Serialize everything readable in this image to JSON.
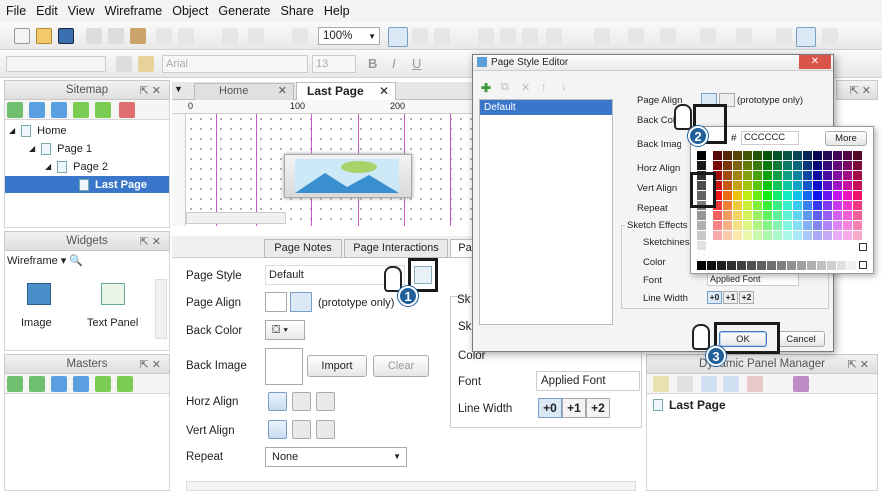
{
  "menu": [
    "File",
    "Edit",
    "View",
    "Wireframe",
    "Object",
    "Generate",
    "Share",
    "Help"
  ],
  "toolbar": {
    "zoom": "100%",
    "font_name": "Arial",
    "font_size": "13"
  },
  "sitemap": {
    "title": "Sitemap",
    "pages": [
      {
        "label": "Home",
        "level": 0
      },
      {
        "label": "Page 1",
        "level": 1
      },
      {
        "label": "Page 2",
        "level": 2
      },
      {
        "label": "Last Page",
        "level": 3,
        "selected": true
      }
    ]
  },
  "widgets": {
    "title": "Widgets",
    "library": "Wireframe",
    "items": [
      {
        "label": "Image"
      },
      {
        "label": "Text Panel"
      }
    ]
  },
  "masters": {
    "title": "Masters"
  },
  "canvas": {
    "tabs": [
      {
        "label": "Home"
      },
      {
        "label": "Last Page",
        "active": true
      }
    ],
    "ruler": [
      "0",
      "100",
      "200"
    ]
  },
  "page_props": {
    "tabs": [
      "Page Notes",
      "Page Interactions",
      "Pa"
    ],
    "page_style_label": "Page Style",
    "page_style_value": "Default",
    "page_align_label": "Page Align",
    "prototype_only": "(prototype only)",
    "back_color_label": "Back Color",
    "back_image_label": "Back Image",
    "import_label": "Import",
    "clear_label": "Clear",
    "horz_align_label": "Horz Align",
    "vert_align_label": "Vert Align",
    "repeat_label": "Repeat",
    "repeat_value": "None"
  },
  "sketch_panel": {
    "title": "Sk",
    "sketchiness_label": "Sk",
    "color_label": "Color",
    "font_label": "Font",
    "font_value": "Applied Font",
    "line_width_label": "Line Width",
    "lw_options": [
      "+0",
      "+1",
      "+2"
    ]
  },
  "dynamic_panel": {
    "title": "Dynamic Panel Manager",
    "item": "Last Page"
  },
  "editor": {
    "title": "Page Style Editor",
    "styles": [
      "Default"
    ],
    "page_align_label": "Page Align",
    "prototype_only": "(prototype only)",
    "back_color_label": "Back Color",
    "back_image_label": "Back Image",
    "horz_align_label": "Horz Align",
    "vert_align_label": "Vert Align",
    "repeat_label": "Repeat",
    "sketch_effects_label": "Sketch Effects",
    "sketchiness_label": "Sketchiness",
    "color_label": "Color",
    "font_label": "Font",
    "font_value": "Applied Font",
    "line_width_label": "Line Width",
    "lw_options": [
      "+0",
      "+1",
      "+2"
    ],
    "ok_label": "OK",
    "cancel_label": "Cancel"
  },
  "color_picker": {
    "hash": "#",
    "hex_value": "CCCCCC",
    "more_label": "More"
  },
  "callouts": [
    "1",
    "2",
    "3"
  ]
}
